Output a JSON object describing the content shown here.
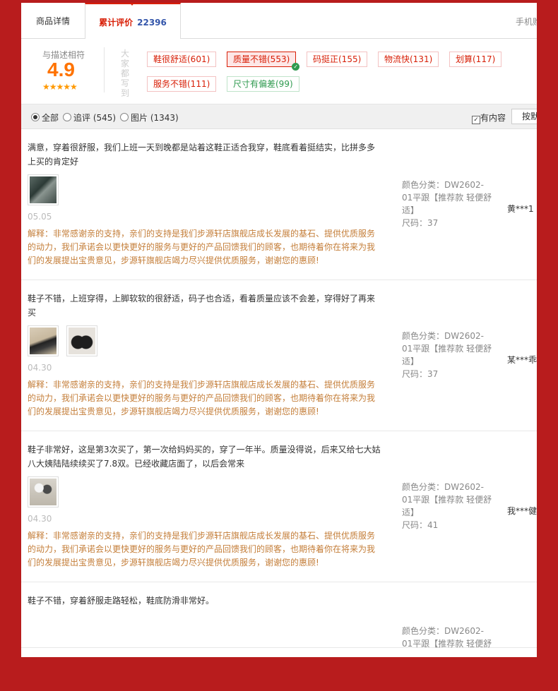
{
  "tabs": {
    "details": "商品详情",
    "reviews": "累计评价",
    "reviews_count": "22396",
    "mobile": "手机购"
  },
  "summary": {
    "label": "与描述相符",
    "score": "4.9",
    "stars": "★★★★★",
    "vertical_text": "大家都写到"
  },
  "tags": [
    {
      "label": "鞋很舒适(601)",
      "selected": false
    },
    {
      "label": "质量不错(553)",
      "selected": true
    },
    {
      "label": "码挺正(155)",
      "selected": false
    },
    {
      "label": "物流快(131)",
      "selected": false
    },
    {
      "label": "划算(117)",
      "selected": false
    },
    {
      "label": "服务不错(111)",
      "selected": false
    },
    {
      "label": "尺寸有偏差(99)",
      "selected": false
    }
  ],
  "filter": {
    "all": "全部",
    "followup": "追评 (545)",
    "images": "图片 (1343)",
    "has_content": "有内容",
    "sort": "按默"
  },
  "reviews": [
    {
      "text": "满意，穿着很舒服，我们上班一天到晚都是站着这鞋正适合我穿，鞋底看着挺结实，比拼多多上买的肯定好",
      "date": "05.05",
      "reply": "解释：非常感谢亲的支持，亲们的支持是我们步源轩店旗舰店成长发展的基石、提供优质服务的动力，我们承诺会以更快更好的服务与更好的产品回馈我们的顾客，也期待着你在将来为我们的发展提出宝贵意见，步源轩旗舰店竭力尽兴提供优质服务，谢谢您的惠顾!",
      "color_label": "颜色分类：DW2602-01平跟【推荐款 轻便舒适】",
      "size_label": "尺码：37",
      "user": "黄***1"
    },
    {
      "text": "鞋子不错，上班穿得，上脚软软的很舒适，码子也合适，看着质量应该不会差，穿得好了再来买",
      "date": "04.30",
      "reply": "解释：非常感谢亲的支持，亲们的支持是我们步源轩店旗舰店成长发展的基石、提供优质服务的动力，我们承诺会以更快更好的服务与更好的产品回馈我们的顾客，也期待着你在将来为我们的发展提出宝贵意见，步源轩旗舰店竭力尽兴提供优质服务，谢谢您的惠顾!",
      "color_label": "颜色分类：DW2602-01平跟【推荐款 轻便舒适】",
      "size_label": "尺码：37",
      "user": "某***乖"
    },
    {
      "text": "鞋子非常好，这是第3次买了，第一次给妈妈买的，穿了一年半。质量没得说，后来又给七大姑八大姨陆陆续续买了7.8双。已经收藏店面了，以后会常来",
      "date": "04.30",
      "reply": "解释：非常感谢亲的支持，亲们的支持是我们步源轩店旗舰店成长发展的基石、提供优质服务的动力，我们承诺会以更快更好的服务与更好的产品回馈我们的顾客，也期待着你在将来为我们的发展提出宝贵意见，步源轩旗舰店竭力尽兴提供优质服务，谢谢您的惠顾!",
      "color_label": "颜色分类：DW2602-01平跟【推荐款 轻便舒适】",
      "size_label": "尺码：41",
      "user": "我***健"
    },
    {
      "text": "鞋子不错，穿着舒服走路轻松，鞋底防滑非常好。",
      "color_label": "颜色分类：DW2602-01平跟【推荐款 轻便舒"
    }
  ]
}
